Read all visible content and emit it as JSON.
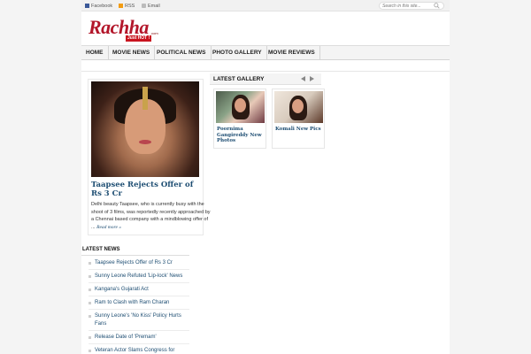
{
  "topbar": {
    "links": [
      {
        "label": "Facebook",
        "icon": "facebook-icon"
      },
      {
        "label": "RSS",
        "icon": "rss-icon"
      },
      {
        "label": "Email",
        "icon": "email-icon"
      }
    ],
    "search_placeholder": "Search in this site..."
  },
  "logo": {
    "name": "Rachha",
    "dotcom": ".com",
    "tagline": "Just HOT !"
  },
  "nav": {
    "items": [
      "HOME",
      "MOVIE NEWS",
      "POLITICAL NEWS",
      "PHOTO GALLERY",
      "MOVIE REVIEWS"
    ]
  },
  "featured": {
    "title": "Taapsee Rejects Offer of Rs 3 Cr",
    "excerpt": "Delhi beauty Taapsee, who is currently busy with the shoot of 3 films, was reportedly recently approached by a Chennai based company with a mindblowing offer of ...",
    "read_more": "Read more »"
  },
  "gallery": {
    "title": "LATEST GALLERY",
    "items": [
      {
        "caption": "Poornima Gangireddy New Photos"
      },
      {
        "caption": "Komali New Pics"
      }
    ]
  },
  "latest_news": {
    "title": "LATEST NEWS",
    "items": [
      "Taapsee Rejects Offer of Rs 3 Cr",
      "Sunny Leone Refuted 'Lip-lock' News",
      "Kangana's Gujarati Act",
      "Ram to Clash with Ram Charan",
      "Sunny Leone's 'No Kiss' Policy Hurts Fans",
      "Release Date of 'Premam'",
      "Veteran Actor Slams Congress for"
    ]
  },
  "colors": {
    "brand_red": "#b3162a",
    "link_blue": "#1d4d72"
  }
}
